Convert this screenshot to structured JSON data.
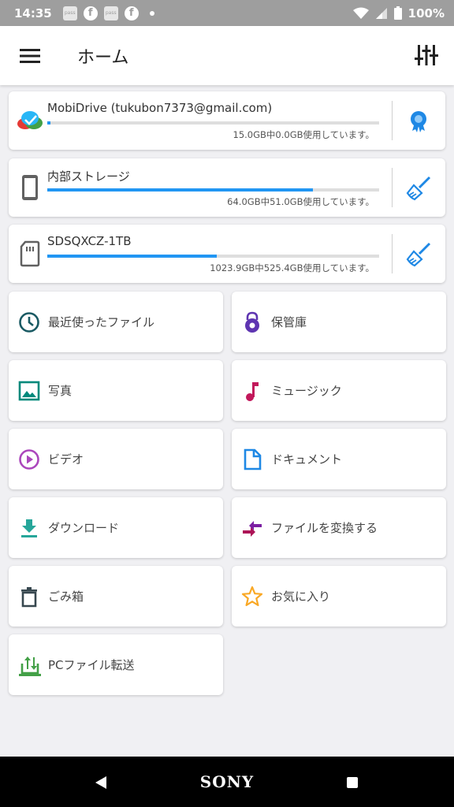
{
  "status_bar": {
    "time": "14:35",
    "notif_pass": "pass",
    "notif_fb": "f",
    "battery": "100%"
  },
  "app_bar": {
    "title": "ホーム"
  },
  "storage": [
    {
      "name": "MobiDrive (tukubon7373@gmail.com)",
      "usage": "15.0GB中0.0GB使用しています。",
      "fill": 0.01,
      "icon": "cloud-icon",
      "action_icon": "award-icon"
    },
    {
      "name": "内部ストレージ",
      "usage": "64.0GB中51.0GB使用しています。",
      "fill": 0.8,
      "icon": "phone-icon",
      "action_icon": "broom-icon"
    },
    {
      "name": "SDSQXCZ-1TB",
      "usage": "1023.9GB中525.4GB使用しています。",
      "fill": 0.51,
      "icon": "sd-card-icon",
      "action_icon": "broom-icon"
    }
  ],
  "categories": {
    "recent": "最近使ったファイル",
    "vault": "保管庫",
    "photos": "写真",
    "music": "ミュージック",
    "video": "ビデオ",
    "documents": "ドキュメント",
    "downloads": "ダウンロード",
    "convert": "ファイルを変換する",
    "trash": "ごみ箱",
    "favorites": "お気に入り",
    "pc_transfer": "PCファイル転送"
  },
  "nav_bar": {
    "brand": "SONY"
  },
  "colors": {
    "accent": "#2196f3",
    "teal": "#00897b",
    "dark_teal": "#1a5a63",
    "purple": "#5e35b1",
    "magenta": "#c2185b",
    "violet": "#ab47bc",
    "orange": "#f9a825",
    "green": "#43a047",
    "cyan": "#26a69a"
  }
}
